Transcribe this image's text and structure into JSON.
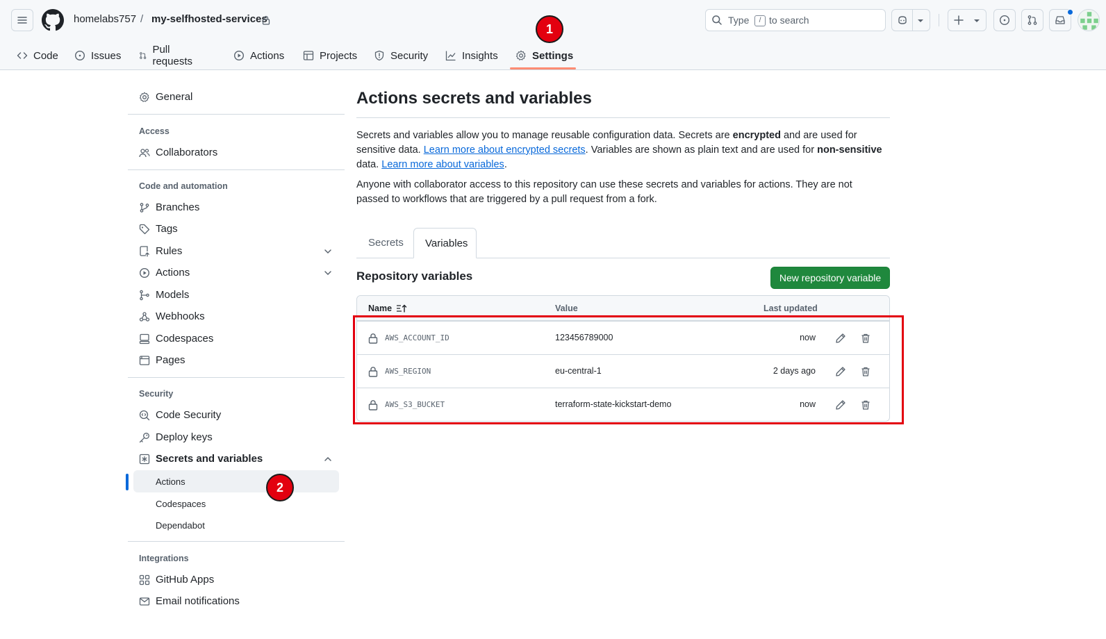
{
  "header": {
    "owner": "homelabs757",
    "separator": "/",
    "repo": "my-selfhosted-services",
    "search_prefix": "Type",
    "search_key": "/",
    "search_suffix": "to search"
  },
  "nav": {
    "tabs": [
      {
        "label": "Code",
        "icon": "code-icon"
      },
      {
        "label": "Issues",
        "icon": "issue-icon"
      },
      {
        "label": "Pull requests",
        "icon": "pull-request-icon"
      },
      {
        "label": "Actions",
        "icon": "play-icon"
      },
      {
        "label": "Projects",
        "icon": "table-icon"
      },
      {
        "label": "Security",
        "icon": "shield-icon"
      },
      {
        "label": "Insights",
        "icon": "graph-icon"
      },
      {
        "label": "Settings",
        "icon": "gear-icon",
        "active": true
      }
    ]
  },
  "annotations": {
    "badge1": "1",
    "badge2": "2",
    "highlight_color": "#e3000f"
  },
  "sidebar": {
    "general": "General",
    "access_heading": "Access",
    "collaborators": "Collaborators",
    "code_heading": "Code and automation",
    "branches": "Branches",
    "tags": "Tags",
    "rules": "Rules",
    "actions": "Actions",
    "models": "Models",
    "webhooks": "Webhooks",
    "codespaces": "Codespaces",
    "pages": "Pages",
    "security_heading": "Security",
    "code_security": "Code Security",
    "deploy_keys": "Deploy keys",
    "secrets_vars": "Secrets and variables",
    "sub_actions": "Actions",
    "sub_codespaces": "Codespaces",
    "sub_dependabot": "Dependabot",
    "integrations_heading": "Integrations",
    "github_apps": "GitHub Apps",
    "email_notifications": "Email notifications"
  },
  "main": {
    "title": "Actions secrets and variables",
    "p1_a": "Secrets and variables allow you to manage reusable configuration data. Secrets are ",
    "p1_b": "encrypted",
    "p1_c": " and are used for sensitive data. ",
    "p1_link1": "Learn more about encrypted secrets",
    "p1_d": ". Variables are shown as plain text and are used for ",
    "p1_e": "non-sensitive",
    "p1_f": " data. ",
    "p1_link2": "Learn more about variables",
    "p1_g": ".",
    "p2": "Anyone with collaborator access to this repository can use these secrets and variables for actions. They are not passed to workflows that are triggered by a pull request from a fork.",
    "tab_secrets": "Secrets",
    "tab_variables": "Variables",
    "section_title": "Repository variables",
    "new_button": "New repository variable",
    "columns": {
      "name": "Name",
      "value": "Value",
      "updated": "Last updated"
    },
    "rows": [
      {
        "name": "AWS_ACCOUNT_ID",
        "value": "123456789000",
        "updated": "now"
      },
      {
        "name": "AWS_REGION",
        "value": "eu-central-1",
        "updated": "2 days ago"
      },
      {
        "name": "AWS_S3_BUCKET",
        "value": "terraform-state-kickstart-demo",
        "updated": "now"
      }
    ]
  }
}
